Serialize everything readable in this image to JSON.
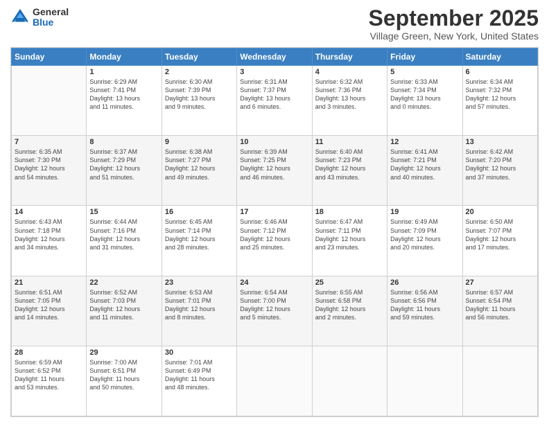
{
  "header": {
    "logo_general": "General",
    "logo_blue": "Blue",
    "month_title": "September 2025",
    "location": "Village Green, New York, United States"
  },
  "weekdays": [
    "Sunday",
    "Monday",
    "Tuesday",
    "Wednesday",
    "Thursday",
    "Friday",
    "Saturday"
  ],
  "weeks": [
    [
      {
        "day": "",
        "lines": []
      },
      {
        "day": "1",
        "lines": [
          "Sunrise: 6:29 AM",
          "Sunset: 7:41 PM",
          "Daylight: 13 hours",
          "and 11 minutes."
        ]
      },
      {
        "day": "2",
        "lines": [
          "Sunrise: 6:30 AM",
          "Sunset: 7:39 PM",
          "Daylight: 13 hours",
          "and 9 minutes."
        ]
      },
      {
        "day": "3",
        "lines": [
          "Sunrise: 6:31 AM",
          "Sunset: 7:37 PM",
          "Daylight: 13 hours",
          "and 6 minutes."
        ]
      },
      {
        "day": "4",
        "lines": [
          "Sunrise: 6:32 AM",
          "Sunset: 7:36 PM",
          "Daylight: 13 hours",
          "and 3 minutes."
        ]
      },
      {
        "day": "5",
        "lines": [
          "Sunrise: 6:33 AM",
          "Sunset: 7:34 PM",
          "Daylight: 13 hours",
          "and 0 minutes."
        ]
      },
      {
        "day": "6",
        "lines": [
          "Sunrise: 6:34 AM",
          "Sunset: 7:32 PM",
          "Daylight: 12 hours",
          "and 57 minutes."
        ]
      }
    ],
    [
      {
        "day": "7",
        "lines": [
          "Sunrise: 6:35 AM",
          "Sunset: 7:30 PM",
          "Daylight: 12 hours",
          "and 54 minutes."
        ]
      },
      {
        "day": "8",
        "lines": [
          "Sunrise: 6:37 AM",
          "Sunset: 7:29 PM",
          "Daylight: 12 hours",
          "and 51 minutes."
        ]
      },
      {
        "day": "9",
        "lines": [
          "Sunrise: 6:38 AM",
          "Sunset: 7:27 PM",
          "Daylight: 12 hours",
          "and 49 minutes."
        ]
      },
      {
        "day": "10",
        "lines": [
          "Sunrise: 6:39 AM",
          "Sunset: 7:25 PM",
          "Daylight: 12 hours",
          "and 46 minutes."
        ]
      },
      {
        "day": "11",
        "lines": [
          "Sunrise: 6:40 AM",
          "Sunset: 7:23 PM",
          "Daylight: 12 hours",
          "and 43 minutes."
        ]
      },
      {
        "day": "12",
        "lines": [
          "Sunrise: 6:41 AM",
          "Sunset: 7:21 PM",
          "Daylight: 12 hours",
          "and 40 minutes."
        ]
      },
      {
        "day": "13",
        "lines": [
          "Sunrise: 6:42 AM",
          "Sunset: 7:20 PM",
          "Daylight: 12 hours",
          "and 37 minutes."
        ]
      }
    ],
    [
      {
        "day": "14",
        "lines": [
          "Sunrise: 6:43 AM",
          "Sunset: 7:18 PM",
          "Daylight: 12 hours",
          "and 34 minutes."
        ]
      },
      {
        "day": "15",
        "lines": [
          "Sunrise: 6:44 AM",
          "Sunset: 7:16 PM",
          "Daylight: 12 hours",
          "and 31 minutes."
        ]
      },
      {
        "day": "16",
        "lines": [
          "Sunrise: 6:45 AM",
          "Sunset: 7:14 PM",
          "Daylight: 12 hours",
          "and 28 minutes."
        ]
      },
      {
        "day": "17",
        "lines": [
          "Sunrise: 6:46 AM",
          "Sunset: 7:12 PM",
          "Daylight: 12 hours",
          "and 25 minutes."
        ]
      },
      {
        "day": "18",
        "lines": [
          "Sunrise: 6:47 AM",
          "Sunset: 7:11 PM",
          "Daylight: 12 hours",
          "and 23 minutes."
        ]
      },
      {
        "day": "19",
        "lines": [
          "Sunrise: 6:49 AM",
          "Sunset: 7:09 PM",
          "Daylight: 12 hours",
          "and 20 minutes."
        ]
      },
      {
        "day": "20",
        "lines": [
          "Sunrise: 6:50 AM",
          "Sunset: 7:07 PM",
          "Daylight: 12 hours",
          "and 17 minutes."
        ]
      }
    ],
    [
      {
        "day": "21",
        "lines": [
          "Sunrise: 6:51 AM",
          "Sunset: 7:05 PM",
          "Daylight: 12 hours",
          "and 14 minutes."
        ]
      },
      {
        "day": "22",
        "lines": [
          "Sunrise: 6:52 AM",
          "Sunset: 7:03 PM",
          "Daylight: 12 hours",
          "and 11 minutes."
        ]
      },
      {
        "day": "23",
        "lines": [
          "Sunrise: 6:53 AM",
          "Sunset: 7:01 PM",
          "Daylight: 12 hours",
          "and 8 minutes."
        ]
      },
      {
        "day": "24",
        "lines": [
          "Sunrise: 6:54 AM",
          "Sunset: 7:00 PM",
          "Daylight: 12 hours",
          "and 5 minutes."
        ]
      },
      {
        "day": "25",
        "lines": [
          "Sunrise: 6:55 AM",
          "Sunset: 6:58 PM",
          "Daylight: 12 hours",
          "and 2 minutes."
        ]
      },
      {
        "day": "26",
        "lines": [
          "Sunrise: 6:56 AM",
          "Sunset: 6:56 PM",
          "Daylight: 11 hours",
          "and 59 minutes."
        ]
      },
      {
        "day": "27",
        "lines": [
          "Sunrise: 6:57 AM",
          "Sunset: 6:54 PM",
          "Daylight: 11 hours",
          "and 56 minutes."
        ]
      }
    ],
    [
      {
        "day": "28",
        "lines": [
          "Sunrise: 6:59 AM",
          "Sunset: 6:52 PM",
          "Daylight: 11 hours",
          "and 53 minutes."
        ]
      },
      {
        "day": "29",
        "lines": [
          "Sunrise: 7:00 AM",
          "Sunset: 6:51 PM",
          "Daylight: 11 hours",
          "and 50 minutes."
        ]
      },
      {
        "day": "30",
        "lines": [
          "Sunrise: 7:01 AM",
          "Sunset: 6:49 PM",
          "Daylight: 11 hours",
          "and 48 minutes."
        ]
      },
      {
        "day": "",
        "lines": []
      },
      {
        "day": "",
        "lines": []
      },
      {
        "day": "",
        "lines": []
      },
      {
        "day": "",
        "lines": []
      }
    ]
  ]
}
